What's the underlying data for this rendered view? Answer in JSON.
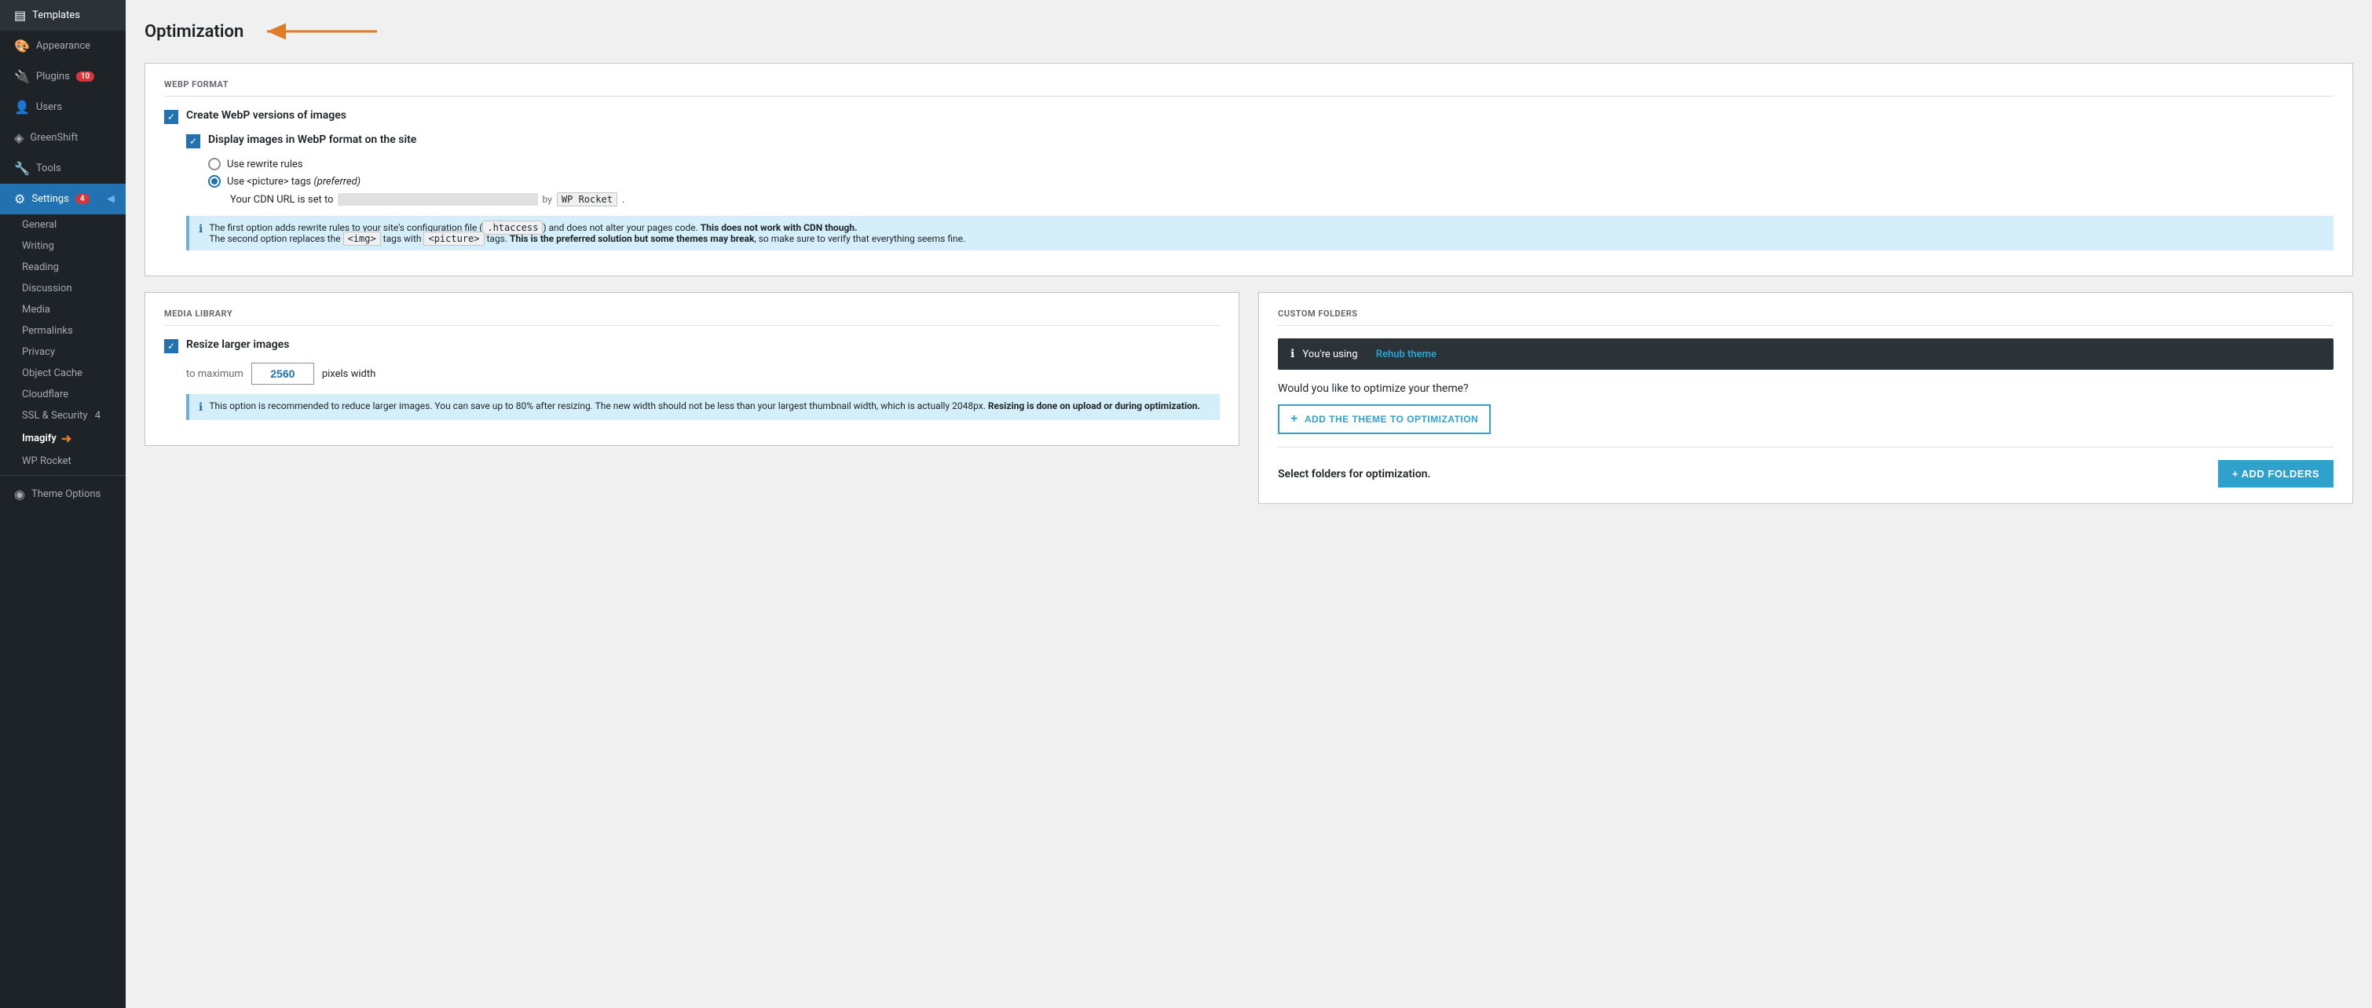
{
  "sidebar": {
    "items": [
      {
        "id": "templates",
        "label": "Templates",
        "icon": "▤",
        "active": false
      },
      {
        "id": "appearance",
        "label": "Appearance",
        "icon": "🎨",
        "active": false
      },
      {
        "id": "plugins",
        "label": "Plugins",
        "icon": "🔌",
        "badge": "10",
        "active": false
      },
      {
        "id": "users",
        "label": "Users",
        "icon": "👤",
        "active": false
      },
      {
        "id": "greenshift",
        "label": "GreenShift",
        "icon": "◈",
        "active": false
      },
      {
        "id": "tools",
        "label": "Tools",
        "icon": "🔧",
        "active": false
      },
      {
        "id": "settings",
        "label": "Settings",
        "icon": "⚙",
        "badge": "4",
        "active": true
      }
    ],
    "sub_items": [
      {
        "id": "general",
        "label": "General"
      },
      {
        "id": "writing",
        "label": "Writing"
      },
      {
        "id": "reading",
        "label": "Reading"
      },
      {
        "id": "discussion",
        "label": "Discussion"
      },
      {
        "id": "media",
        "label": "Media"
      },
      {
        "id": "permalinks",
        "label": "Permalinks"
      },
      {
        "id": "privacy",
        "label": "Privacy"
      },
      {
        "id": "object-cache",
        "label": "Object Cache"
      },
      {
        "id": "cloudflare",
        "label": "Cloudflare"
      },
      {
        "id": "ssl-security",
        "label": "SSL & Security",
        "badge": "4"
      },
      {
        "id": "imagify",
        "label": "Imagify",
        "active": true,
        "arrow": true
      },
      {
        "id": "wp-rocket",
        "label": "WP Rocket"
      }
    ],
    "bottom_items": [
      {
        "id": "theme-options",
        "label": "Theme Options",
        "icon": "◉"
      }
    ]
  },
  "page": {
    "title": "Optimization",
    "sections": {
      "webp": {
        "label": "WEBP FORMAT",
        "create_webp_label": "Create WebP versions of images",
        "display_webp_label": "Display images in WebP format on the site",
        "create_checked": true,
        "display_checked": true,
        "radio_options": [
          {
            "id": "rewrite",
            "label": "Use rewrite rules",
            "selected": false
          },
          {
            "id": "picture",
            "label": "Use <picture> tags",
            "note": "(preferred)",
            "selected": true
          }
        ],
        "cdn_text": "Your CDN URL is set to",
        "cdn_url": "████████████████████████████",
        "cdn_by": "by",
        "cdn_provider": "WP Rocket",
        "info1_text": "The first option adds rewrite rules to your site's configuration file (",
        "info1_htaccess": ".htaccess",
        "info1_rest": ") and does not alter your pages code.",
        "info1_bold": "This does not work with CDN though.",
        "info2_text": "The second option replaces the ",
        "info2_img": "<img>",
        "info2_middle": " tags with ",
        "info2_picture": "<picture>",
        "info2_rest": " tags.",
        "info2_bold": "This is the preferred solution but some themes may break",
        "info2_end": ", so make sure to verify that everything seems fine."
      },
      "media_library": {
        "label": "MEDIA LIBRARY",
        "resize_label": "Resize larger images",
        "resize_checked": true,
        "to_max_label": "to maximum",
        "max_value": "2560",
        "px_label": "pixels width",
        "info_text": "This option is recommended to reduce larger images. You can save up to 80% after resizing. The new width should not be less than your largest thumbnail width, which is actually 2048px.",
        "info_bold": "Resizing is done on upload or during optimization."
      },
      "custom_folders": {
        "label": "CUSTOM FOLDERS",
        "theme_info": "You're using",
        "theme_name": "Rehub theme",
        "optimize_prompt": "Would you like to optimize your theme?",
        "add_theme_btn": "ADD THE THEME TO OPTIMIZATION",
        "select_folders_label": "Select folders for optimization.",
        "add_folders_btn": "+ ADD FOLDERS"
      }
    }
  }
}
